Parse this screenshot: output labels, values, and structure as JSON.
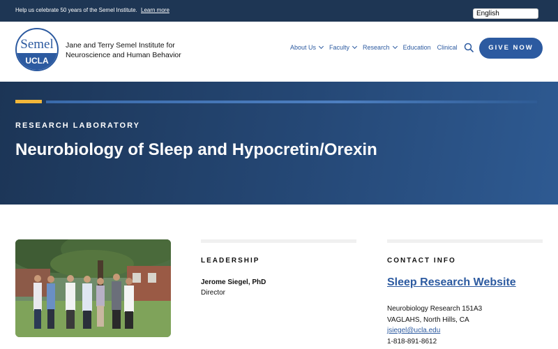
{
  "topbar": {
    "announcement": "Help us celebrate 50 years of the Semel Institute.",
    "learn_more": "Learn more",
    "language": "English"
  },
  "header": {
    "logo_top": "Semel",
    "logo_bottom": "UCLA",
    "institute_name": "Jane and Terry Semel Institute for Neuroscience and Human Behavior"
  },
  "nav": {
    "items": [
      {
        "label": "About Us"
      },
      {
        "label": "Faculty"
      },
      {
        "label": "Research"
      },
      {
        "label": "Education"
      },
      {
        "label": "Clinical"
      }
    ],
    "give_label": "GIVE NOW"
  },
  "hero": {
    "eyebrow": "RESEARCH LABORATORY",
    "title": "Neurobiology of Sleep and Hypocretin/Orexin"
  },
  "leadership": {
    "heading": "LEADERSHIP",
    "name": "Jerome Siegel, PhD",
    "role": "Director"
  },
  "contact": {
    "heading": "CONTACT INFO",
    "website_label": "Sleep Research Website",
    "address_line1": "Neurobiology Research 151A3",
    "address_line2": "VAGLAHS, North Hills, CA",
    "email": "jsiegel@ucla.edu",
    "phone": "1-818-891-8612"
  },
  "colors": {
    "brand_blue": "#2c5aa0",
    "topbar": "#1e3654",
    "accent_gold": "#f2b73a"
  }
}
